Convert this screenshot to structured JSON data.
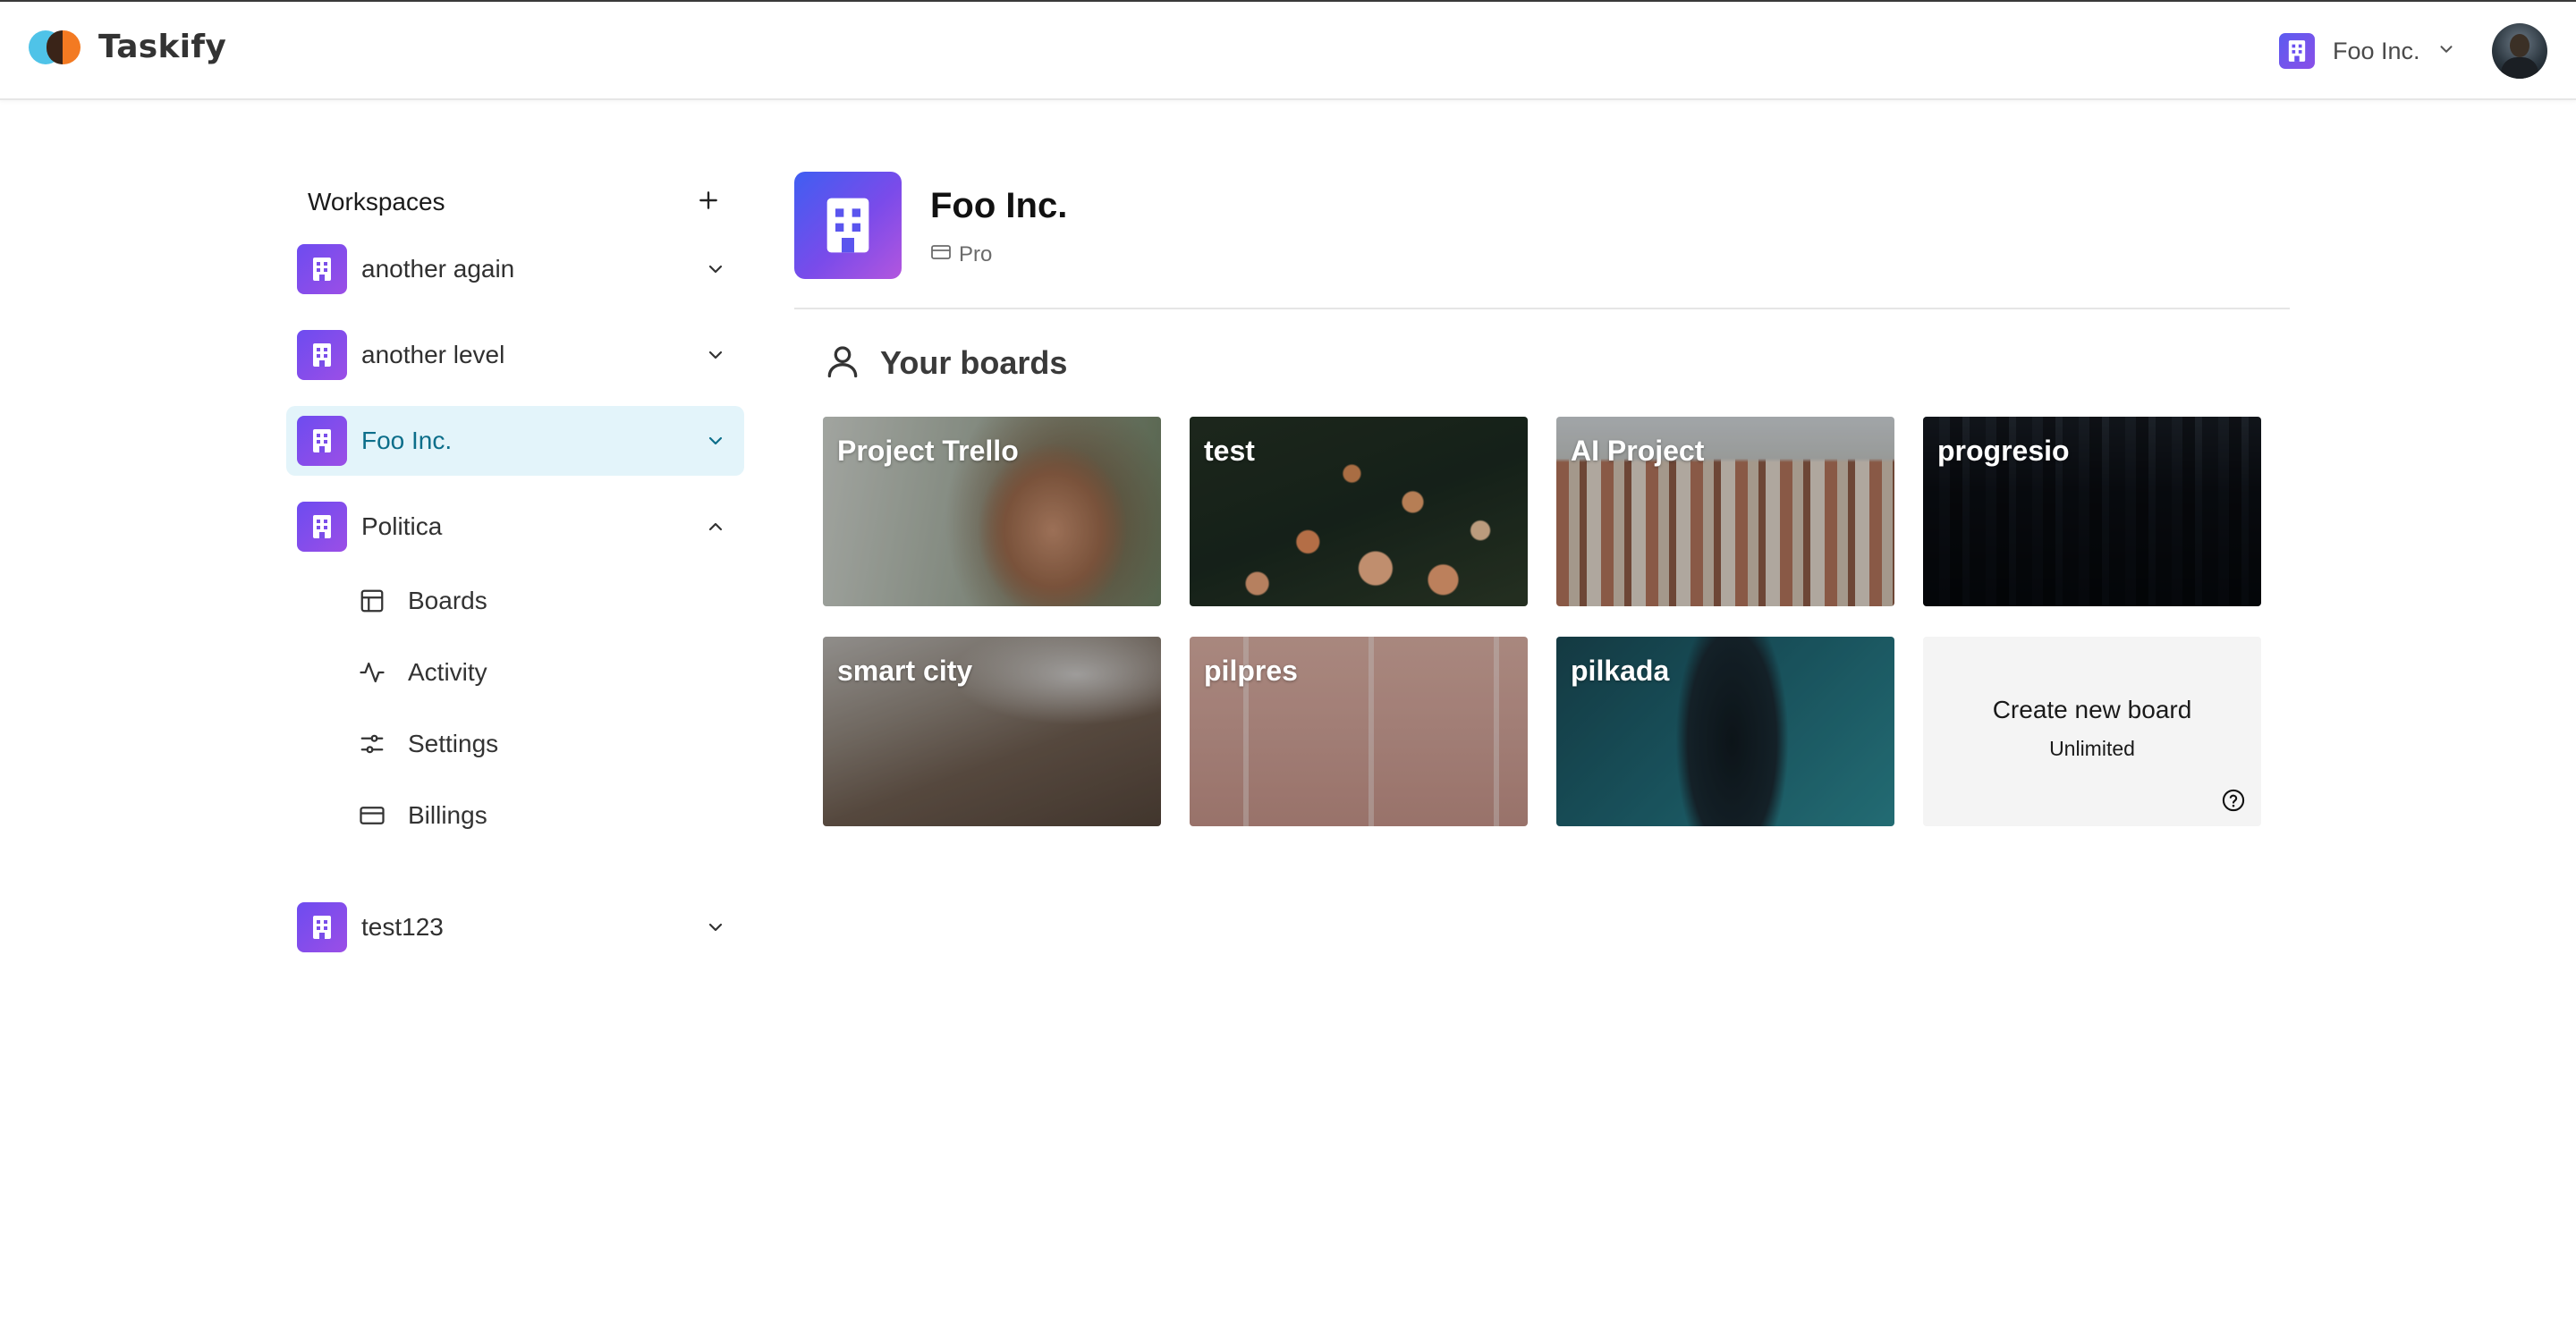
{
  "app": {
    "name": "Taskify"
  },
  "header": {
    "org_name": "Foo Inc."
  },
  "sidebar": {
    "title": "Workspaces",
    "workspaces": [
      {
        "label": "another again",
        "expanded": false,
        "active": false
      },
      {
        "label": "another level",
        "expanded": false,
        "active": false
      },
      {
        "label": "Foo Inc.",
        "expanded": false,
        "active": true
      },
      {
        "label": "Politica",
        "expanded": true,
        "active": false
      },
      {
        "label": "test123",
        "expanded": false,
        "active": false
      }
    ],
    "sub_items": [
      {
        "label": "Boards",
        "icon": "layout-icon"
      },
      {
        "label": "Activity",
        "icon": "activity-icon"
      },
      {
        "label": "Settings",
        "icon": "settings-icon"
      },
      {
        "label": "Billings",
        "icon": "credit-card-icon"
      }
    ]
  },
  "workspace": {
    "name": "Foo Inc.",
    "plan": "Pro"
  },
  "boards": {
    "heading": "Your boards",
    "items": [
      {
        "title": "Project Trello"
      },
      {
        "title": "test"
      },
      {
        "title": "AI Project"
      },
      {
        "title": "progresio"
      },
      {
        "title": "smart city"
      },
      {
        "title": "pilpres"
      },
      {
        "title": "pilkada"
      }
    ],
    "create": {
      "label": "Create new board",
      "sublabel": "Unlimited"
    }
  },
  "colors": {
    "active_bg": "#e3f4fa",
    "active_text": "#0c6e8a",
    "org_gradient_start": "#6d4cf0",
    "org_gradient_end": "#9b4ee6"
  }
}
